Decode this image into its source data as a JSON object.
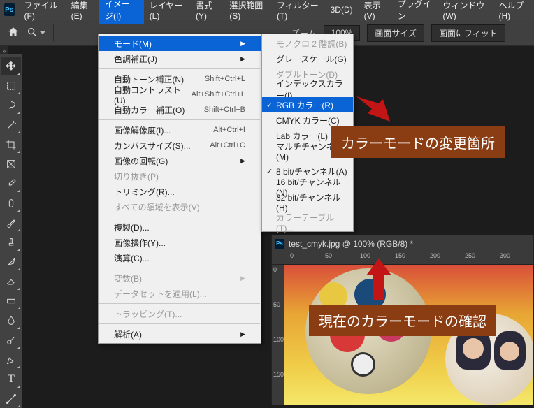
{
  "menubar": {
    "logo": "Ps",
    "items": [
      "ファイル(F)",
      "編集(E)",
      "イメージ(I)",
      "レイヤー(L)",
      "書式(Y)",
      "選択範囲(S)",
      "フィルター(T)",
      "3D(D)",
      "表示(V)",
      "プラグイン",
      "ウィンドウ(W)",
      "ヘルプ(H)"
    ],
    "active_index": 2
  },
  "optbar": {
    "zoom_label": "ズーム",
    "percent": "100%",
    "canvas_size": "画面サイズ",
    "fit": "画面にフィット"
  },
  "image_menu": {
    "sections": [
      [
        {
          "label": "モード(M)",
          "sub": "",
          "arrow": true,
          "hl": true
        },
        {
          "label": "色調補正(J)",
          "sub": "",
          "arrow": true
        }
      ],
      [
        {
          "label": "自動トーン補正(N)",
          "sub": "Shift+Ctrl+L"
        },
        {
          "label": "自動コントラスト(U)",
          "sub": "Alt+Shift+Ctrl+L"
        },
        {
          "label": "自動カラー補正(O)",
          "sub": "Shift+Ctrl+B"
        }
      ],
      [
        {
          "label": "画像解像度(I)...",
          "sub": "Alt+Ctrl+I"
        },
        {
          "label": "カンバスサイズ(S)...",
          "sub": "Alt+Ctrl+C"
        },
        {
          "label": "画像の回転(G)",
          "sub": "",
          "arrow": true
        },
        {
          "label": "切り抜き(P)",
          "disabled": true
        },
        {
          "label": "トリミング(R)..."
        },
        {
          "label": "すべての領域を表示(V)",
          "disabled": true
        }
      ],
      [
        {
          "label": "複製(D)..."
        },
        {
          "label": "画像操作(Y)..."
        },
        {
          "label": "演算(C)..."
        }
      ],
      [
        {
          "label": "変数(B)",
          "sub": "",
          "arrow": true,
          "disabled": true
        },
        {
          "label": "データセットを適用(L)...",
          "disabled": true
        }
      ],
      [
        {
          "label": "トラッピング(T)...",
          "disabled": true
        }
      ],
      [
        {
          "label": "解析(A)",
          "sub": "",
          "arrow": true
        }
      ]
    ]
  },
  "mode_submenu": {
    "sections": [
      [
        {
          "label": "モノクロ 2 階調(B)",
          "disabled": true
        },
        {
          "label": "グレースケール(G)"
        },
        {
          "label": "ダブルトーン(D)",
          "disabled": true
        },
        {
          "label": "インデックスカラー(I)..."
        },
        {
          "label": "RGB カラー(R)",
          "hl": true,
          "check": true
        },
        {
          "label": "CMYK カラー(C)"
        },
        {
          "label": "Lab カラー(L)"
        },
        {
          "label": "マルチチャンネル(M)"
        }
      ],
      [
        {
          "label": "8 bit/チャンネル(A)",
          "check": true
        },
        {
          "label": "16 bit/チャンネル(N)"
        },
        {
          "label": "32 bit/チャンネル(H)"
        }
      ],
      [
        {
          "label": "カラーテーブル(T)...",
          "disabled": true
        }
      ]
    ]
  },
  "document": {
    "title": "test_cmyk.jpg @ 100% (RGB/8) *",
    "ruler_h": [
      0,
      50,
      100,
      150,
      200,
      250,
      300
    ],
    "ruler_v": [
      0,
      50,
      100,
      150
    ]
  },
  "callouts": {
    "c1": "カラーモードの変更箇所",
    "c2": "現在のカラーモードの確認"
  },
  "tools": [
    "move",
    "marquee",
    "lasso",
    "wand",
    "crop",
    "frame",
    "eyedrop",
    "patch",
    "brush",
    "stamp",
    "history",
    "eraser",
    "gradient",
    "blur",
    "dodge",
    "pen",
    "type",
    "path"
  ]
}
